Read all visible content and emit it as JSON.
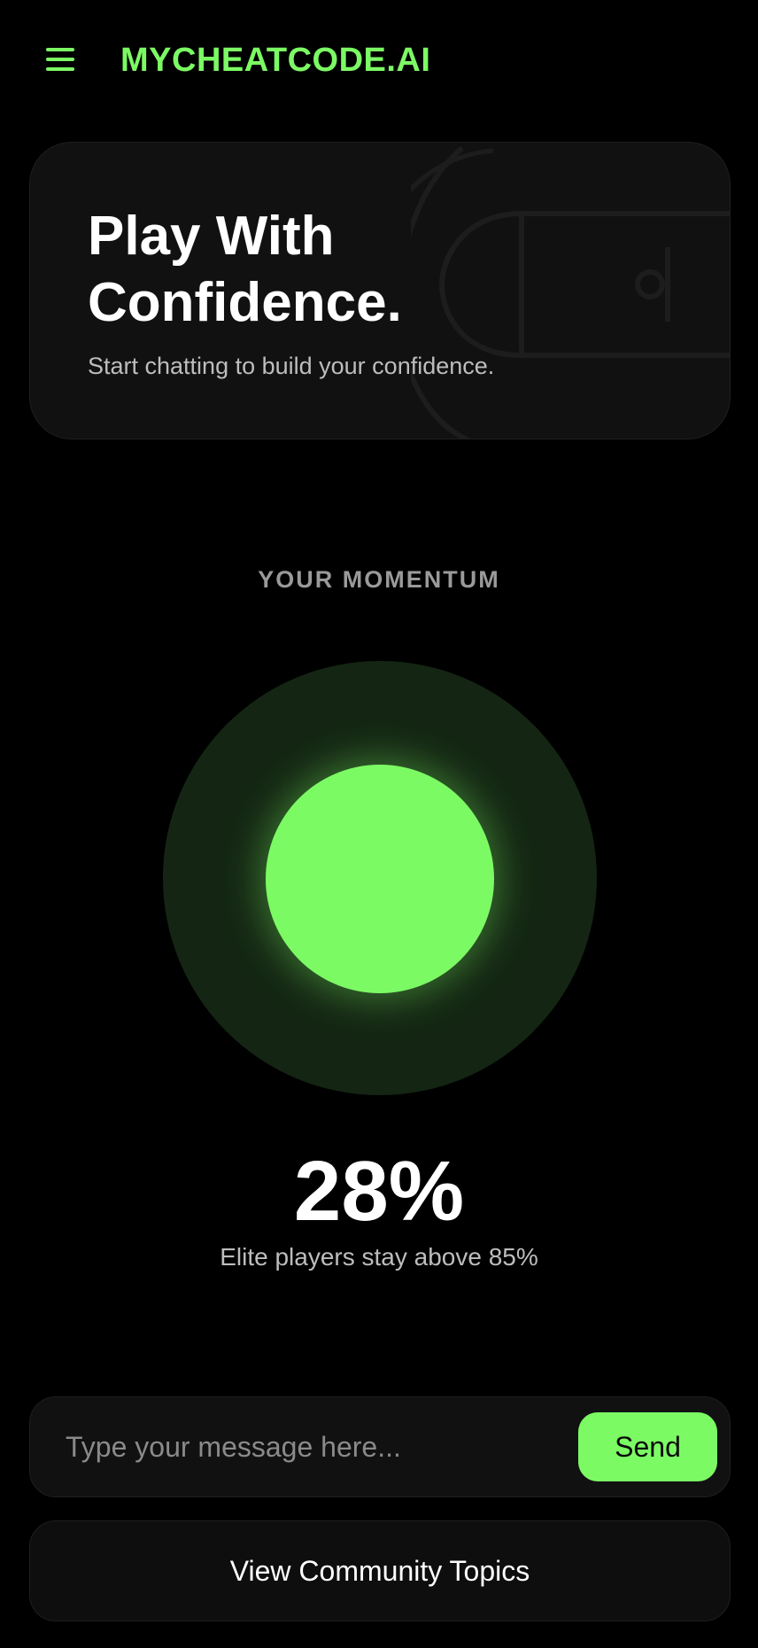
{
  "header": {
    "brand": "MYCHEATCODE.AI",
    "menu_icon": "hamburger-menu-icon"
  },
  "hero": {
    "title": "Play With Confidence.",
    "subtitle": "Start chatting to build your confidence.",
    "background_graphic": "basketball-court-icon"
  },
  "momentum": {
    "label": "YOUR MOMENTUM",
    "value_text": "28%",
    "value": 28,
    "caption": "Elite players stay above 85%"
  },
  "chat": {
    "placeholder": "Type your message here...",
    "value": "",
    "send_label": "Send"
  },
  "community": {
    "button_label": "View Community Topics"
  },
  "colors": {
    "accent": "#7cfa64",
    "background": "#000000",
    "card": "#111111",
    "ring": "#142613"
  }
}
